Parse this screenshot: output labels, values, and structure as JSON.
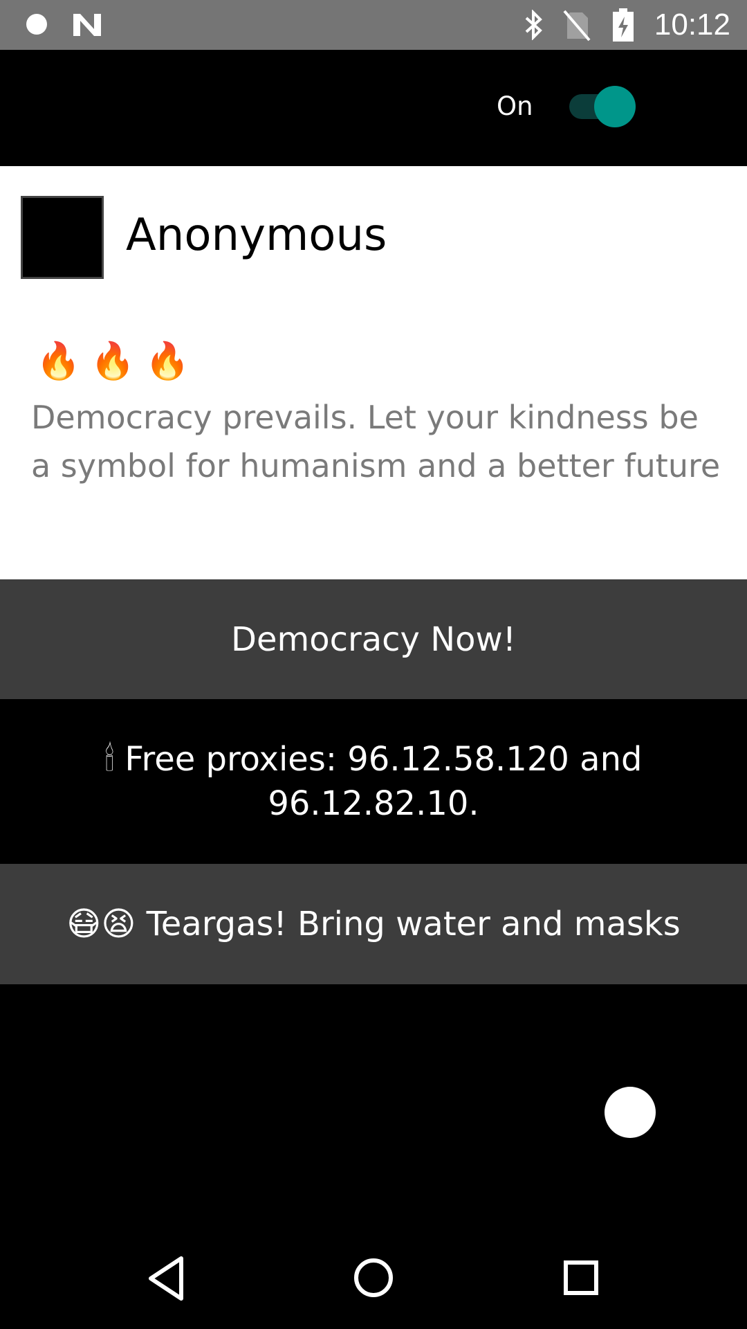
{
  "status_bar": {
    "time": "10:12",
    "icons": [
      "notification-dot-icon",
      "n-notification-icon",
      "bluetooth-icon",
      "no-sim-icon",
      "battery-charging-icon"
    ]
  },
  "app_bar": {
    "toggle_label": "On",
    "toggle_state": "on",
    "accent_color": "#00968a"
  },
  "post": {
    "author": "Anonymous",
    "emojis": "🔥🔥🔥",
    "text": "Democracy prevails. Let your kindness be a symbol for humanism and a better future"
  },
  "banners": [
    {
      "text": "Democracy Now!"
    },
    {
      "text": "🕯 Free proxies: 96.12.58.120 and 96.12.82.10."
    },
    {
      "text": "😷😫 Teargas! Bring water and masks"
    }
  ],
  "nav_bar": {
    "icons": [
      "back-icon",
      "home-icon",
      "recents-icon"
    ]
  }
}
